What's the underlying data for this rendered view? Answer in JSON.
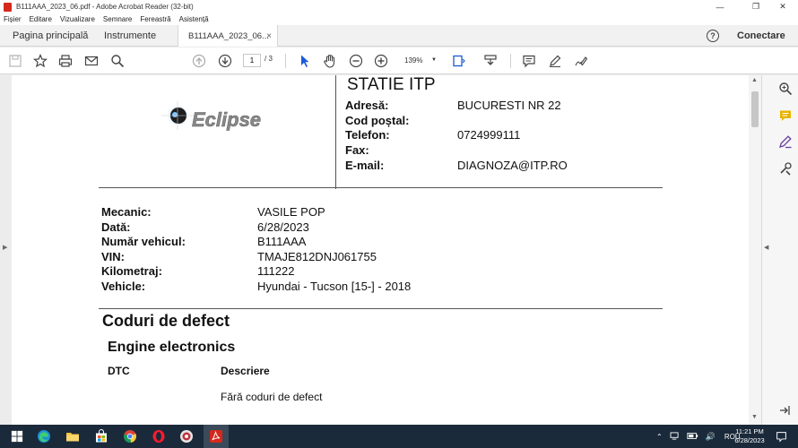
{
  "window": {
    "title": "B111AAA_2023_06.pdf - Adobe Acrobat Reader (32-bit)",
    "controls": [
      "minimize-icon",
      "maximize-icon",
      "close-icon"
    ]
  },
  "menu": [
    "Fișier",
    "Editare",
    "Vizualizare",
    "Semnare",
    "Fereastră",
    "Asistență"
  ],
  "tabs": {
    "home": "Pagina principală",
    "tools": "Instrumente",
    "document": "B111AAA_2023_06...",
    "close_glyph": "×"
  },
  "header_right": {
    "help": "?",
    "signin": "Conectare"
  },
  "toolbar": {
    "page_current": "1",
    "page_total": "/ 3",
    "zoom": "139%"
  },
  "document": {
    "logo_text": "Eclipse",
    "station": {
      "title": "STATIE ITP",
      "fields": [
        {
          "label": "Adresă:",
          "value": "BUCURESTI NR 22"
        },
        {
          "label": "Cod poștal:",
          "value": ""
        },
        {
          "label": "Telefon:",
          "value": "0724999111"
        },
        {
          "label": "Fax:",
          "value": ""
        },
        {
          "label": "E-mail:",
          "value": "DIAGNOZA@ITP.RO"
        }
      ]
    },
    "vehicle_info": [
      {
        "label": "Mecanic:",
        "value": "VASILE POP"
      },
      {
        "label": "Dată:",
        "value": "6/28/2023"
      },
      {
        "label": "Număr vehicul:",
        "value": "B111AAA"
      },
      {
        "label": "VIN:",
        "value": "TMAJE812DNJ061755"
      },
      {
        "label": "Kilometraj:",
        "value": "111222"
      },
      {
        "label": "Vehicle:",
        "value": "Hyundai - Tucson [15-] - 2018"
      }
    ],
    "section_title": "Coduri de defect",
    "subsection_title": "Engine electronics",
    "columns": {
      "dtc": "DTC",
      "description": "Descriere"
    },
    "no_codes": "Fără coduri de defect"
  },
  "taskbar": {
    "language": "ROU",
    "time": "11:21 PM",
    "date": "6/28/2023"
  },
  "colors": {
    "acrobat_red": "#d4291c",
    "taskbar": "#1b2a3a",
    "annotation_yellow": "#e8b400",
    "annotation_purple": "#6b3fa0"
  }
}
